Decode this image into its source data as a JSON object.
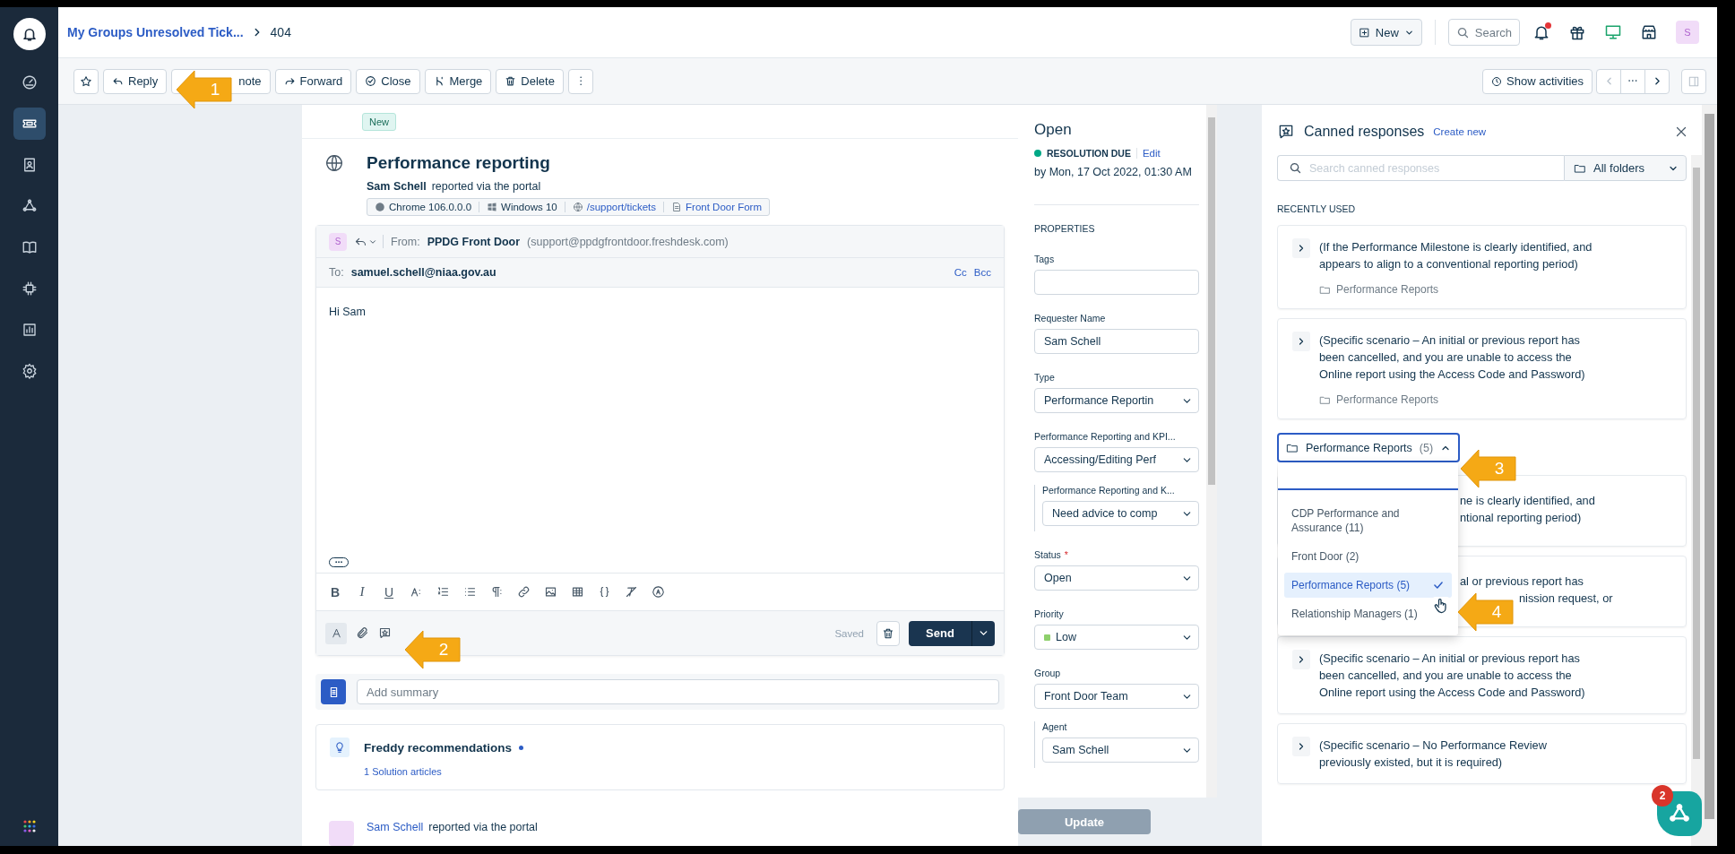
{
  "header": {
    "breadcrumb": "My Groups Unresolved Tick...",
    "ticket_number": "404",
    "new_button": "New",
    "search_button": "Search",
    "avatar": "S",
    "notification_dot": true
  },
  "sidebar": {
    "items": [
      {
        "selected": false
      },
      {
        "selected": true
      },
      {
        "selected": false
      },
      {
        "selected": false
      },
      {
        "selected": false
      },
      {
        "selected": false
      },
      {
        "selected": false
      },
      {
        "selected": false
      }
    ]
  },
  "toolbar": {
    "starred": false,
    "buttons": [
      {
        "label": "Reply"
      },
      {
        "label": "note"
      },
      {
        "label": "Forward"
      },
      {
        "label": "Close"
      },
      {
        "label": "Merge"
      },
      {
        "label": "Delete"
      }
    ],
    "show_activities": "Show activities"
  },
  "ticket": {
    "status_tag": "New",
    "title": "Performance reporting",
    "requester": "Sam Schell",
    "via": "reported via the portal",
    "meta": [
      {
        "kind": "browser",
        "text": "Chrome 106.0.0.0"
      },
      {
        "kind": "os",
        "text": "Windows 10"
      },
      {
        "kind": "url",
        "text": "/support/tickets"
      },
      {
        "kind": "form",
        "text": "Front Door Form"
      }
    ]
  },
  "reply": {
    "avatar": "S",
    "from_label": "From:",
    "from_name": "PPDG Front Door",
    "from_email": "(support@ppdgfrontdoor.freshdesk.com)",
    "to_label": "To:",
    "to": "samuel.schell@niaa.gov.au",
    "cc": "Cc",
    "bcc": "Bcc",
    "body": "Hi Sam",
    "format_tools": [
      {
        "kind": "bold",
        "glyph": "B"
      },
      {
        "kind": "italic",
        "glyph": "I"
      },
      {
        "kind": "underline",
        "glyph": "U"
      },
      {
        "kind": "font-size"
      },
      {
        "kind": "ordered-list"
      },
      {
        "kind": "bullet-list"
      },
      {
        "kind": "paragraph"
      },
      {
        "kind": "link"
      },
      {
        "kind": "image"
      },
      {
        "kind": "table"
      },
      {
        "kind": "code"
      },
      {
        "kind": "clear-format"
      },
      {
        "kind": "spellcheck"
      }
    ],
    "saved": "Saved",
    "send": "Send"
  },
  "summary": {
    "placeholder": "Add summary"
  },
  "freddy": {
    "title": "Freddy recommendations",
    "link": "1 Solution articles"
  },
  "activity": {
    "name": "Sam Schell",
    "via": "reported via the portal"
  },
  "properties": {
    "status": "Open",
    "sla_label": "RESOLUTION DUE",
    "edit": "Edit",
    "due": "by Mon, 17 Oct 2022, 01:30 AM",
    "section": "PROPERTIES",
    "fields": [
      {
        "kind": "text",
        "label": "Tags"
      },
      {
        "kind": "text",
        "label": "Requester Name",
        "value": "Sam Schell"
      },
      {
        "kind": "select",
        "label": "Type",
        "value": "Performance Reportin"
      },
      {
        "kind": "select",
        "label": "Performance Reporting and KPI...",
        "value": "Accessing/Editing Perf",
        "children": [
          {
            "kind": "select",
            "label": "Performance Reporting and K...",
            "value": "Need advice to comp"
          }
        ]
      },
      {
        "kind": "select",
        "label": "Status",
        "required_mark": "*",
        "value": "Open"
      },
      {
        "kind": "select",
        "label": "Priority",
        "value": "Low",
        "color": "#8ed06c"
      },
      {
        "kind": "select",
        "label": "Group",
        "value": "Front Door Team",
        "children": [
          {
            "kind": "select",
            "label": "Agent",
            "value": "Sam Schell"
          }
        ]
      }
    ],
    "update": "Update",
    "update_disabled": true
  },
  "canned": {
    "title": "Canned responses",
    "create": "Create new",
    "search_placeholder": "Search canned responses",
    "folder_filter": "All folders",
    "section": "RECENTLY USED",
    "recent": [
      {
        "text": "(If the Performance Milestone is clearly identified, and appears to align to a conventional reporting period)",
        "folder": "Performance Reports"
      },
      {
        "text": "(Specific scenario – An initial or previous report has been cancelled, and you are unable to access the Online report using the Access Code and Password)",
        "folder": "Performance Reports"
      }
    ],
    "folder_select": {
      "value": "Performance Reports",
      "count": "(5)",
      "expanded": true,
      "options": [
        {
          "label": "CDP Performance and Assurance (11)",
          "selected": false
        },
        {
          "label": "Front Door (2)",
          "selected": false
        },
        {
          "label": "Performance Reports (5)",
          "selected": true
        },
        {
          "label": "Relationship Managers (1)",
          "selected": false
        }
      ]
    },
    "responses": [
      {
        "kind": "partial",
        "lines": [
          "ne is clearly identified, and",
          "ntional reporting period)"
        ]
      },
      {
        "kind": "partial",
        "lines": [
          "al or previous report has",
          "nission request, or"
        ]
      },
      {
        "kind": "full",
        "text": "(Specific scenario – An initial or previous report has been cancelled, and you are unable to access the Online report using the Access Code and Password)"
      },
      {
        "kind": "full",
        "text": "(Specific scenario – No Performance Review previously existed, but it is required)"
      }
    ]
  },
  "help_widget": {
    "badge": "2"
  },
  "callouts": [
    {
      "number": "1"
    },
    {
      "number": "2"
    },
    {
      "number": "3"
    },
    {
      "number": "4"
    }
  ]
}
